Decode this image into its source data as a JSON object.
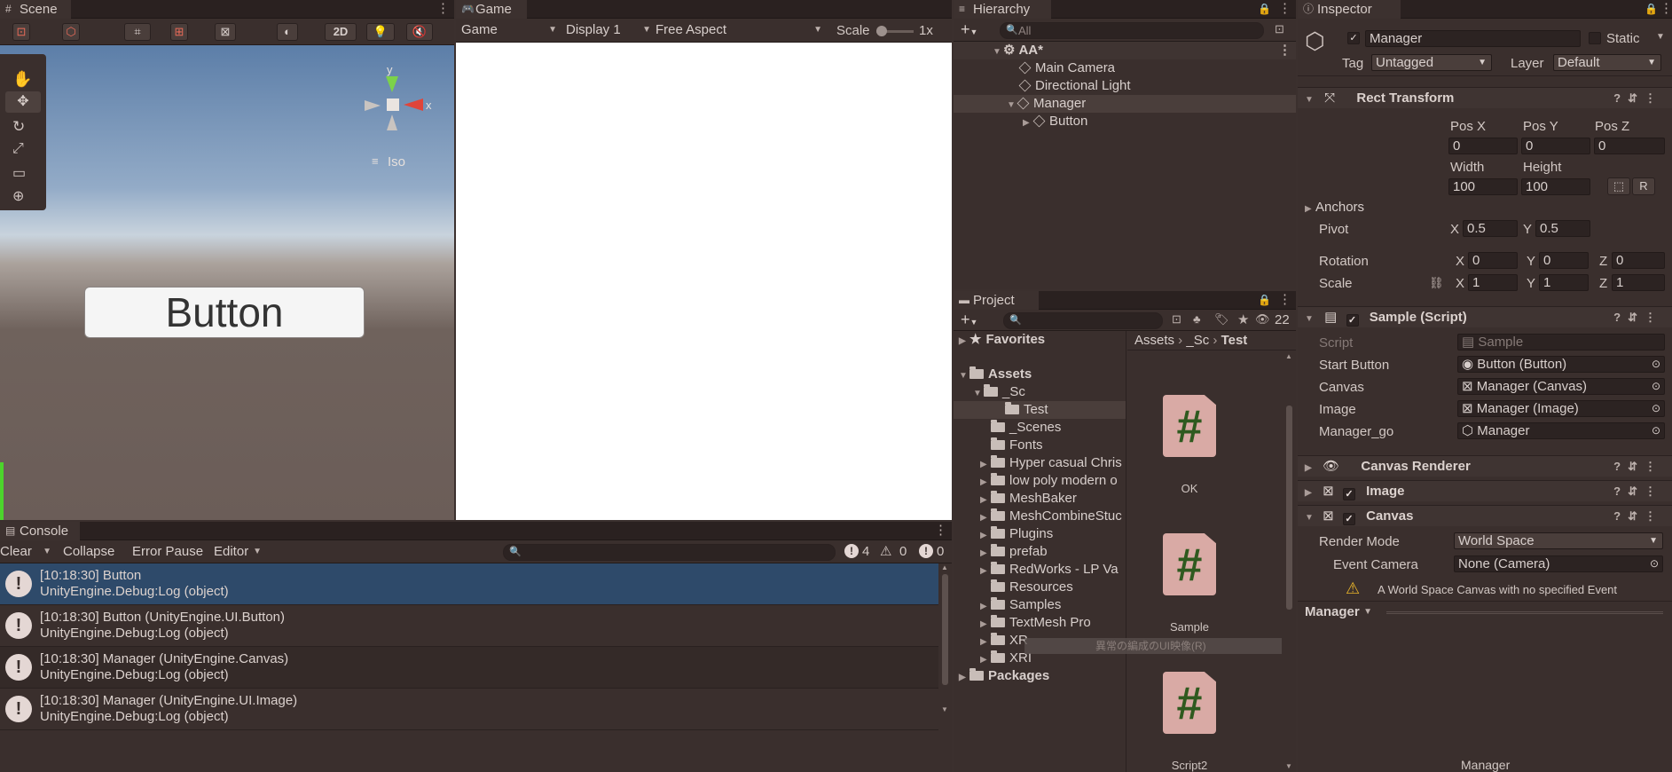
{
  "scene": {
    "tab": "Scene",
    "mode2d": "2D",
    "iso": "Iso",
    "axis_y": "y",
    "axis_x": "x",
    "button_text": "Button"
  },
  "game": {
    "tab": "Game",
    "view_dd": "Game",
    "display_dd": "Display 1",
    "aspect_dd": "Free Aspect",
    "scale_label": "Scale",
    "scale_value": "1x"
  },
  "hierarchy": {
    "tab": "Hierarchy",
    "search_placeholder": "All",
    "scene_name": "AA*",
    "items": [
      "Main Camera",
      "Directional Light",
      "Manager",
      "Button"
    ]
  },
  "project": {
    "tab": "Project",
    "hidden_count": "22",
    "favorites": "Favorites",
    "assets": "Assets",
    "folders": [
      "_Sc",
      "Test",
      "_Scenes",
      "Fonts",
      "Hyper casual Chris",
      "low poly modern o",
      "MeshBaker",
      "MeshCombineStuc",
      "Plugins",
      "prefab",
      "RedWorks - LP Va",
      "Resources",
      "Samples",
      "TextMesh Pro",
      "XR",
      "XRI"
    ],
    "packages": "Packages",
    "breadcrumb": [
      "Assets",
      "_Sc",
      "Test"
    ],
    "assets_list": [
      "OK",
      "Sample",
      "Script2"
    ],
    "tooltip": "異常の編成のUI映像(R)"
  },
  "console": {
    "tab": "Console",
    "clear": "Clear",
    "collapse": "Collapse",
    "error_pause": "Error Pause",
    "editor": "Editor",
    "counts": {
      "log": "4",
      "warn": "0",
      "error": "0"
    },
    "rows": [
      [
        "[10:18:30] Button",
        "UnityEngine.Debug:Log (object)"
      ],
      [
        "[10:18:30] Button (UnityEngine.UI.Button)",
        "UnityEngine.Debug:Log (object)"
      ],
      [
        "[10:18:30] Manager (UnityEngine.Canvas)",
        "UnityEngine.Debug:Log (object)"
      ],
      [
        "[10:18:30] Manager (UnityEngine.UI.Image)",
        "UnityEngine.Debug:Log (object)"
      ]
    ]
  },
  "inspector": {
    "tab": "Inspector",
    "name": "Manager",
    "static": "Static",
    "tag_label": "Tag",
    "tag": "Untagged",
    "layer_label": "Layer",
    "layer": "Default",
    "rect": {
      "title": "Rect Transform",
      "posx_l": "Pos X",
      "posy_l": "Pos Y",
      "posz_l": "Pos Z",
      "posx": "0",
      "posy": "0",
      "posz": "0",
      "width_l": "Width",
      "height_l": "Height",
      "width": "100",
      "height": "100",
      "anchors": "Anchors",
      "pivot": "Pivot",
      "pivot_x": "0.5",
      "pivot_y": "0.5",
      "rotation": "Rotation",
      "rx": "0",
      "ry": "0",
      "rz": "0",
      "scale": "Scale",
      "sx": "1",
      "sy": "1",
      "sz": "1",
      "X": "X",
      "Y": "Y",
      "Z": "Z"
    },
    "script": {
      "title": "Sample (Script)",
      "script_l": "Script",
      "script_v": "Sample",
      "start_l": "Start Button",
      "start_v": "Button (Button)",
      "canvas_l": "Canvas",
      "canvas_v": "Manager (Canvas)",
      "image_l": "Image",
      "image_v": "Manager (Image)",
      "go_l": "Manager_go",
      "go_v": "Manager"
    },
    "canvas_renderer": "Canvas Renderer",
    "image": "Image",
    "canvas": "Canvas",
    "render_mode_l": "Render Mode",
    "render_mode": "World Space",
    "event_cam_l": "Event Camera",
    "event_cam": "None (Camera)",
    "warning": "A World Space Canvas with no specified Event",
    "footer_dd": "Manager",
    "footer_label": "Manager"
  }
}
